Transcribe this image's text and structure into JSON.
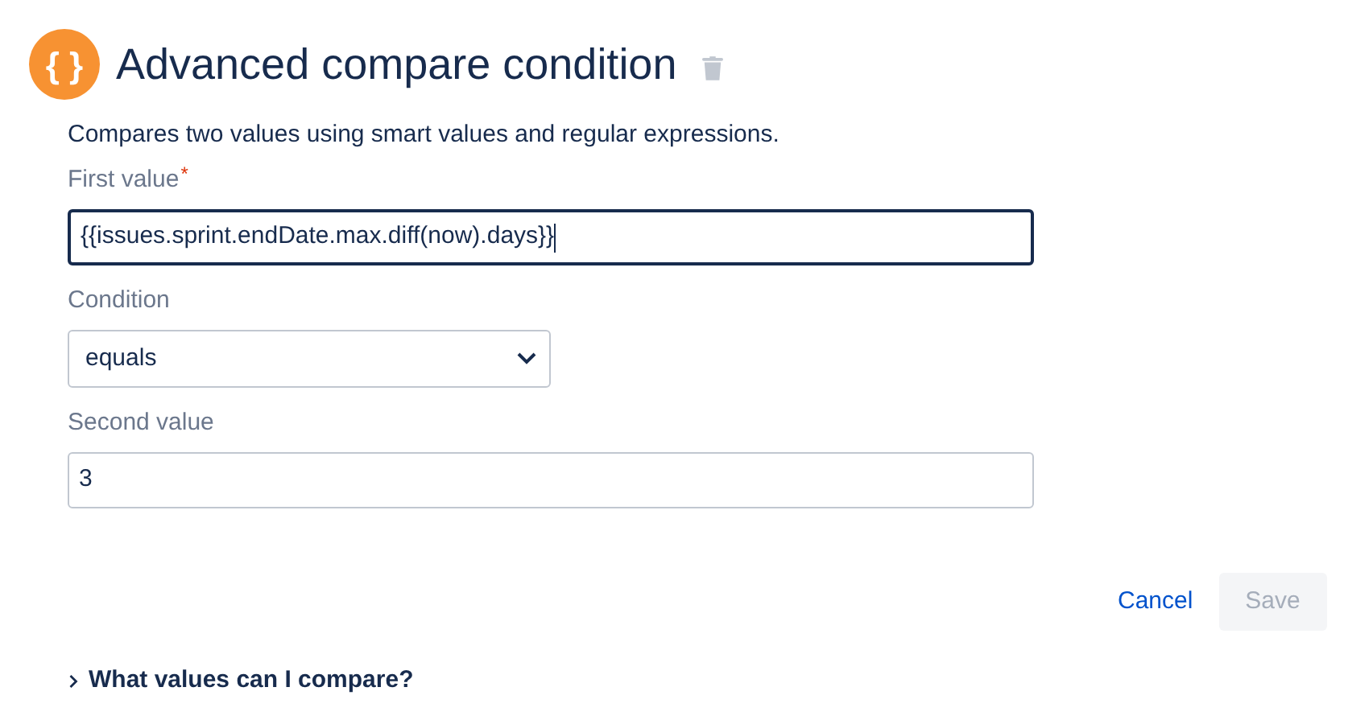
{
  "header": {
    "icon_text": "{ }",
    "title": "Advanced compare condition"
  },
  "description": "Compares two values using smart values and regular expressions.",
  "fields": [
    {
      "kind": "text",
      "label": "First value",
      "required_mark": "*",
      "focused": true,
      "value": "{{issues.sprint.endDate.max.diff(now).days}}"
    },
    {
      "kind": "select",
      "label": "Condition",
      "focused": false,
      "value": "equals"
    },
    {
      "kind": "text",
      "label": "Second value",
      "focused": false,
      "value": "3"
    }
  ],
  "actions": [
    {
      "kind": "link",
      "label": "Cancel",
      "disabled": false
    },
    {
      "kind": "button",
      "label": "Save",
      "disabled": true
    }
  ],
  "help": {
    "label": "What values can I compare?",
    "expanded": false
  }
}
